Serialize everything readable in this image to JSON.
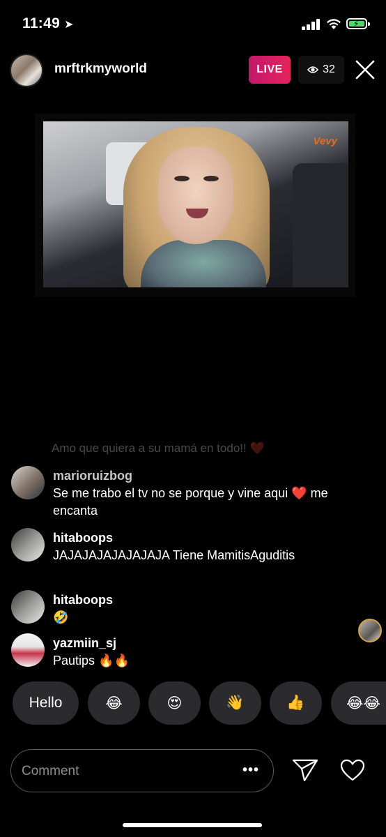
{
  "status_bar": {
    "time": "11:49"
  },
  "header": {
    "username": "mrftrkmyworld",
    "live_label": "LIVE",
    "viewer_count": "32"
  },
  "video": {
    "logo_text": "Vevy"
  },
  "comments": {
    "faded_text": "Amo que quiera a su mamá en todo!! ❤️",
    "items": [
      {
        "username": "marioruizbog",
        "text": "Se me trabo el tv no se porque y vine aqui ❤️ me encanta"
      },
      {
        "username": "hitaboops",
        "text": "JAJAJAJAJAJAJAJA Tiene MamitisAguditis"
      },
      {
        "username": "hitaboops",
        "text": "🤣"
      },
      {
        "username": "yazmiin_sj",
        "text": "Pautips 🔥🔥"
      }
    ]
  },
  "quick_replies": [
    "Hello",
    "😂",
    "😍",
    "👋",
    "👍",
    "😂😂"
  ],
  "composer": {
    "placeholder": "Comment",
    "more_label": "•••"
  },
  "colors": {
    "live_gradient_start": "#c2186b",
    "live_gradient_end": "#e6245c",
    "battery_green": "#4cd964"
  }
}
